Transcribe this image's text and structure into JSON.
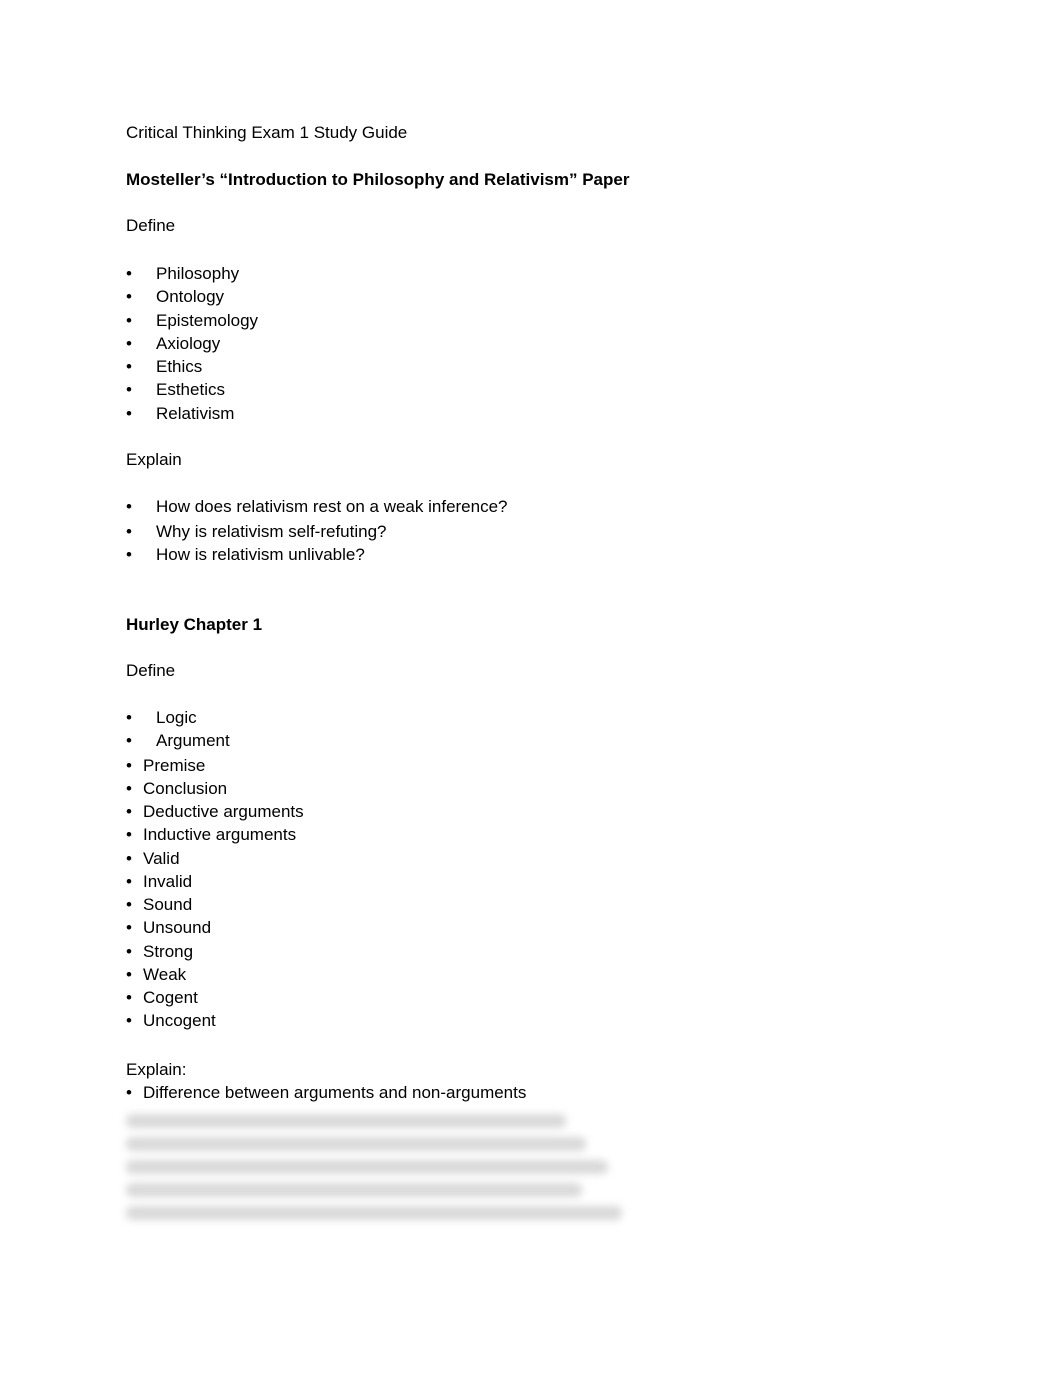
{
  "document": {
    "title": "Critical Thinking Exam 1 Study Guide",
    "section1": {
      "heading": "Mosteller’s “Introduction to Philosophy and Relativism” Paper",
      "define_label": "Define",
      "define_items": [
        "Philosophy",
        "Ontology",
        "Epistemology",
        "Axiology",
        "Ethics",
        "Esthetics",
        "Relativism"
      ],
      "explain_label": "Explain",
      "explain_items": [
        "How does relativism rest on a weak inference?",
        "Why is relativism self-refuting?",
        "How is relativism unlivable?"
      ]
    },
    "section2": {
      "heading": "Hurley Chapter 1",
      "define_label": "Define",
      "define_items": [
        "Logic",
        "Argument",
        "Premise",
        "Conclusion",
        "Deductive arguments",
        "Inductive arguments",
        "Valid",
        "Invalid",
        "Sound",
        "Unsound",
        "Strong",
        "Weak",
        "Cogent",
        "Uncogent"
      ],
      "explain_label": "Explain:",
      "explain_items": [
        "Difference between arguments and non-arguments"
      ],
      "blurred_line_count": 5
    },
    "bullet": "•"
  }
}
